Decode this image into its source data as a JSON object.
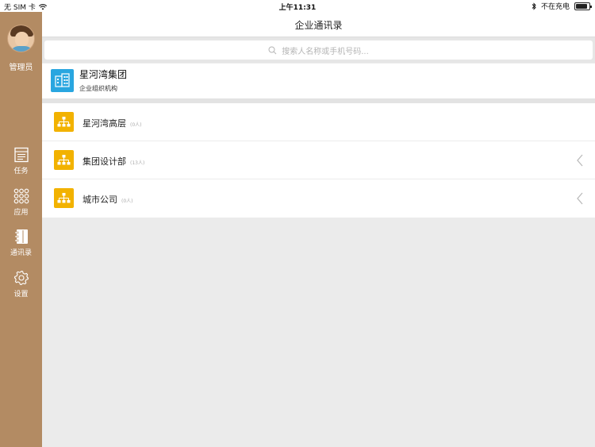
{
  "status_bar": {
    "carrier": "无 SIM 卡",
    "time": "上午11:31",
    "charging": "不在充电",
    "battery_level": 0.85
  },
  "sidebar": {
    "user_label": "管理员",
    "items": [
      {
        "label": "任务",
        "icon": "task-icon"
      },
      {
        "label": "应用",
        "icon": "apps-grid-icon"
      },
      {
        "label": "通讯录",
        "icon": "contacts-book-icon"
      },
      {
        "label": "设置",
        "icon": "gear-icon"
      }
    ]
  },
  "header": {
    "title": "企业通讯录"
  },
  "search": {
    "placeholder": "搜索人名称或手机号码..."
  },
  "org": {
    "name": "星河湾集团",
    "subtitle": "企业组织机构",
    "icon": "building-icon"
  },
  "departments": [
    {
      "name": "星河湾高层",
      "count": "(0人)",
      "has_chevron": false
    },
    {
      "name": "集团设计部",
      "count": "(13人)",
      "has_chevron": true
    },
    {
      "name": "城市公司",
      "count": "(0人)",
      "has_chevron": true
    }
  ],
  "colors": {
    "sidebar_bg": "#b38b63",
    "org_icon": "#29a6e0",
    "dept_icon": "#f2b200"
  }
}
